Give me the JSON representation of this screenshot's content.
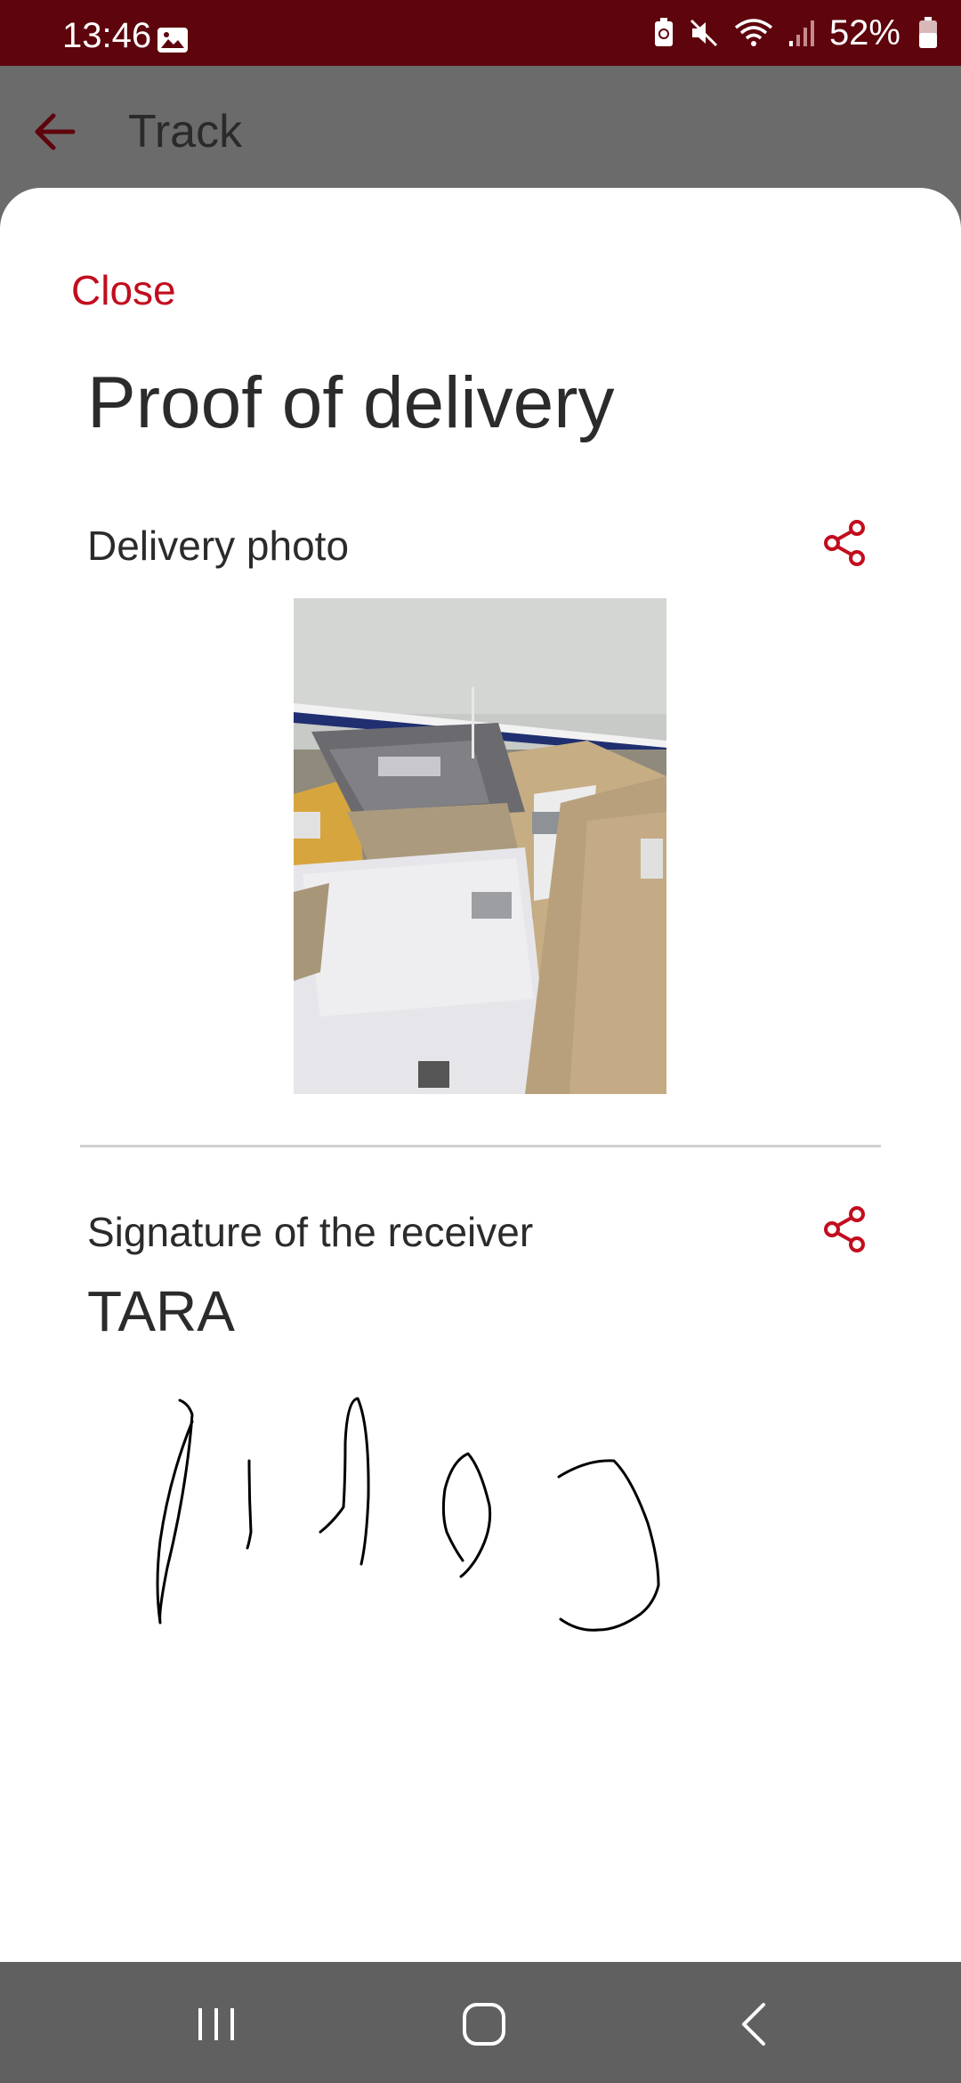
{
  "status_bar": {
    "time": "13:46",
    "battery": "52%",
    "icons": [
      "gallery-icon",
      "battery-saver-icon",
      "mute-icon",
      "wifi-icon",
      "signal-icon",
      "battery-icon"
    ]
  },
  "header": {
    "title": "Track",
    "back_icon": "back-arrow-icon"
  },
  "sheet": {
    "close_label": "Close",
    "title": "Proof of delivery",
    "photo_section": {
      "label": "Delivery photo",
      "share_icon": "share-icon"
    },
    "signature_section": {
      "label": "Signature of the receiver",
      "receiver_name": "TARA",
      "share_icon": "share-icon"
    }
  },
  "nav_bar": {
    "buttons": [
      "recents-icon",
      "home-icon",
      "back-icon"
    ]
  },
  "colors": {
    "status_bar": "#5e040c",
    "accent": "#c20d1e",
    "text": "#2b2b2b",
    "nav_bar": "#606060"
  }
}
